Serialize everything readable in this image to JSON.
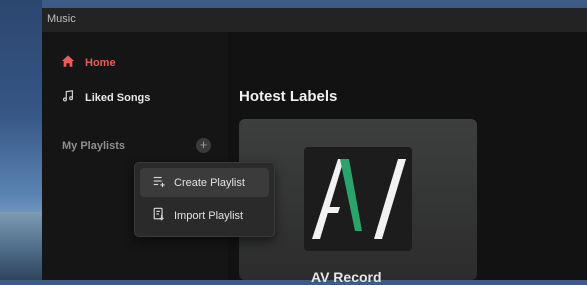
{
  "app": {
    "title": "Music"
  },
  "sidebar": {
    "items": [
      {
        "label": "Home",
        "icon": "home-icon",
        "active": true
      },
      {
        "label": "Liked Songs",
        "icon": "music-note-icon",
        "active": false
      }
    ],
    "playlists_label": "My Playlists",
    "add_icon": "plus-icon"
  },
  "context_menu": {
    "items": [
      {
        "label": "Create Playlist",
        "icon": "playlist-add-icon"
      },
      {
        "label": "Import Playlist",
        "icon": "playlist-import-icon"
      }
    ]
  },
  "main": {
    "section_title": "Hotest Labels",
    "label_card": {
      "name": "AV Record"
    }
  },
  "colors": {
    "accent": "#ee5b5b",
    "logo_green": "#2aa46b"
  }
}
